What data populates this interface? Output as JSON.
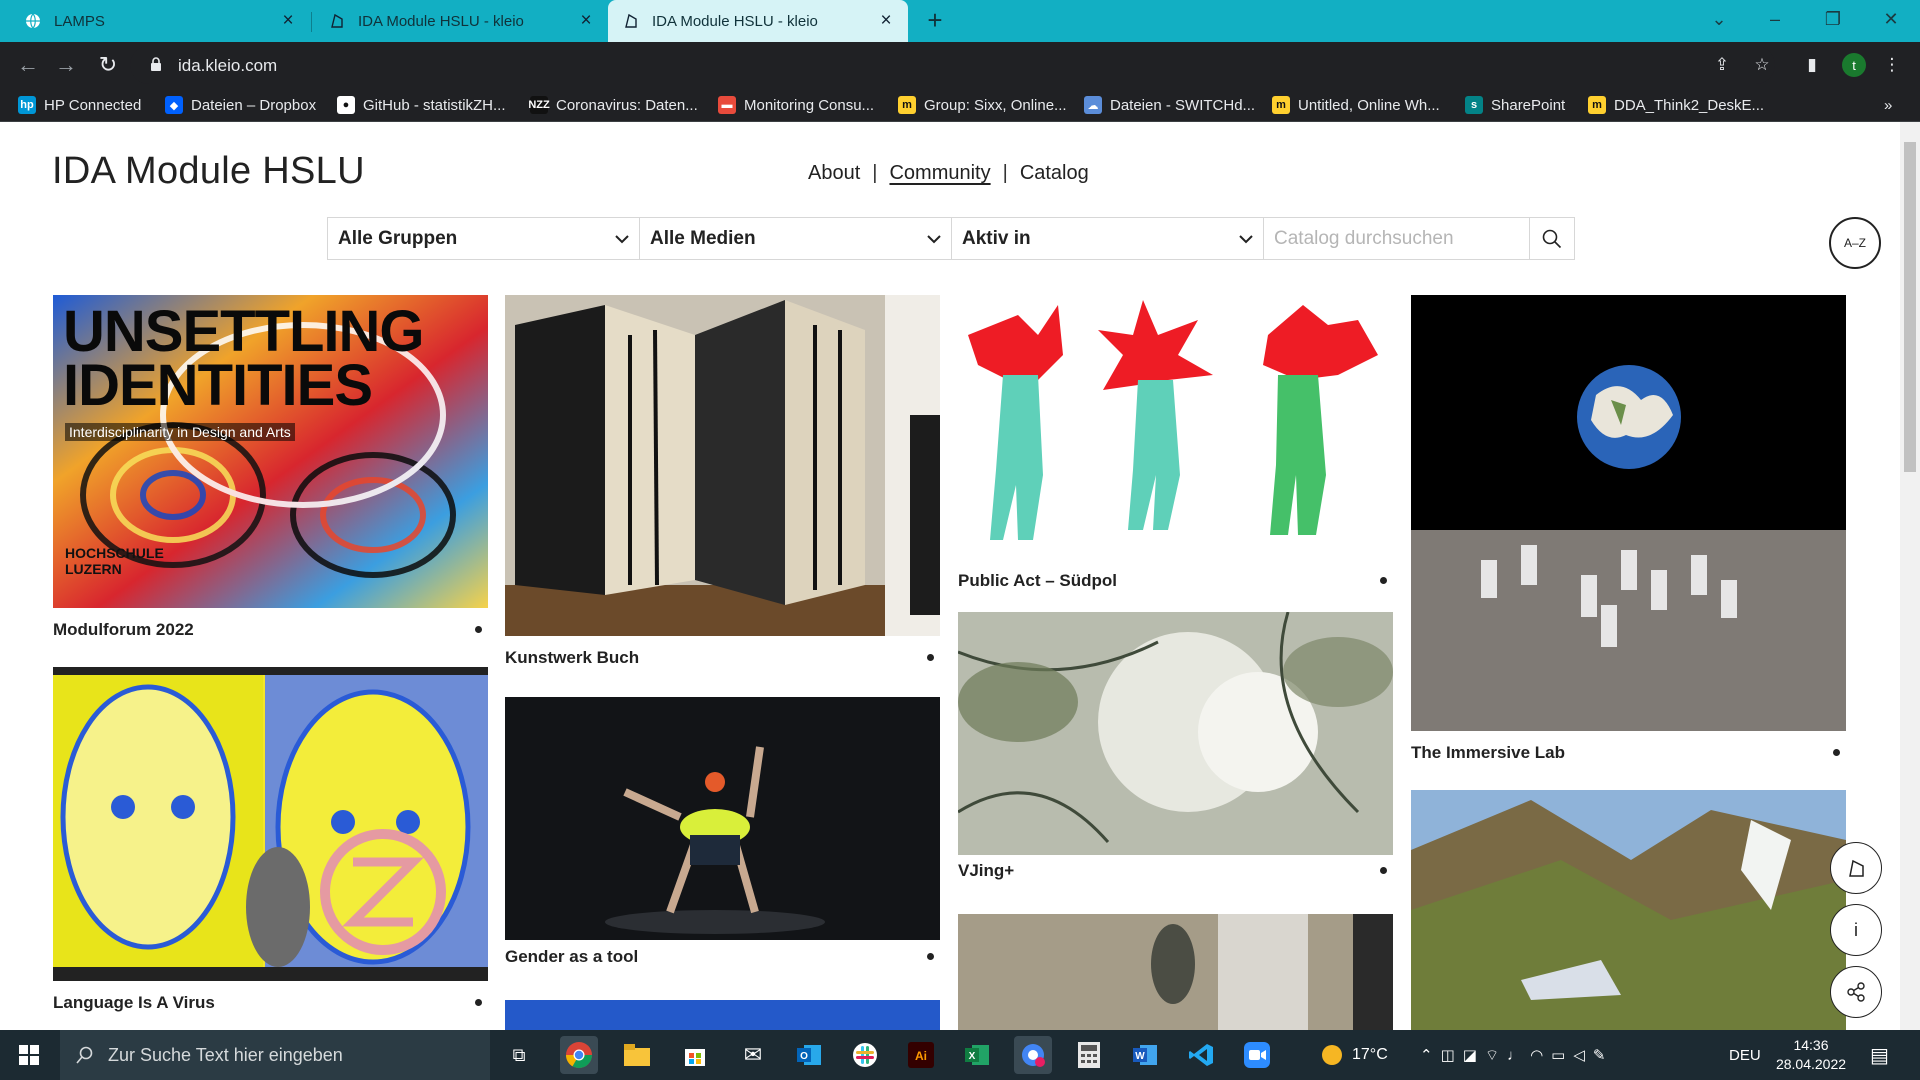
{
  "browser": {
    "tabs": [
      {
        "title": "LAMPS"
      },
      {
        "title": "IDA Module HSLU - kleio"
      },
      {
        "title": "IDA Module HSLU - kleio"
      }
    ],
    "url": "ida.kleio.com",
    "profile_initial": "t"
  },
  "bookmarks": [
    {
      "label": "HP Connected",
      "icon": "hp-icon",
      "color": "#0096d6"
    },
    {
      "label": "Dateien – Dropbox",
      "icon": "dropbox-icon",
      "color": "#0061fe"
    },
    {
      "label": "GitHub - statistikZH...",
      "icon": "github-icon",
      "color": "#ffffff"
    },
    {
      "label": "Coronavirus: Daten...",
      "icon": "nzz-icon",
      "color": "#111111"
    },
    {
      "label": "Monitoring Consu...",
      "icon": "monitoring-icon",
      "color": "#e84b3c"
    },
    {
      "label": "Group: Sixx, Online...",
      "icon": "miro-icon",
      "color": "#ffd02f"
    },
    {
      "label": "Dateien - SWITCHd...",
      "icon": "switchdrive-icon",
      "color": "#5b8dd9"
    },
    {
      "label": "Untitled, Online Wh...",
      "icon": "miro-icon",
      "color": "#ffd02f"
    },
    {
      "label": "SharePoint",
      "icon": "sharepoint-icon",
      "color": "#038387"
    },
    {
      "label": "DDA_Think2_DeskE...",
      "icon": "miro-icon",
      "color": "#ffd02f"
    }
  ],
  "site": {
    "title": "IDA Module HSLU",
    "nav": [
      {
        "label": "About"
      },
      {
        "label": "Community"
      },
      {
        "label": "Catalog"
      }
    ],
    "filters": {
      "groups": "Alle Gruppen",
      "media": "Alle Medien",
      "active": "Aktiv in",
      "search_placeholder": "Catalog durchsuchen"
    },
    "az_label": "A–Z"
  },
  "cards": [
    {
      "title": "Modulforum 2022",
      "overlay_title": "UNSETTLING IDENTITIES",
      "overlay_sub": "Interdisciplinarity in Design and Arts",
      "overlay_org": "HOCHSCHULE LUZERN"
    },
    {
      "title": "Language Is A Virus"
    },
    {
      "title": "Kunstwerk Buch"
    },
    {
      "title": "Gender as a tool"
    },
    {
      "title": "Public Act – Südpol"
    },
    {
      "title": "VJing+"
    },
    {
      "title": "The Immersive Lab"
    }
  ],
  "taskbar": {
    "search_placeholder": "Zur Suche Text hier eingeben",
    "temperature": "17°C",
    "language": "DEU",
    "time": "14:36",
    "date": "28.04.2022"
  }
}
